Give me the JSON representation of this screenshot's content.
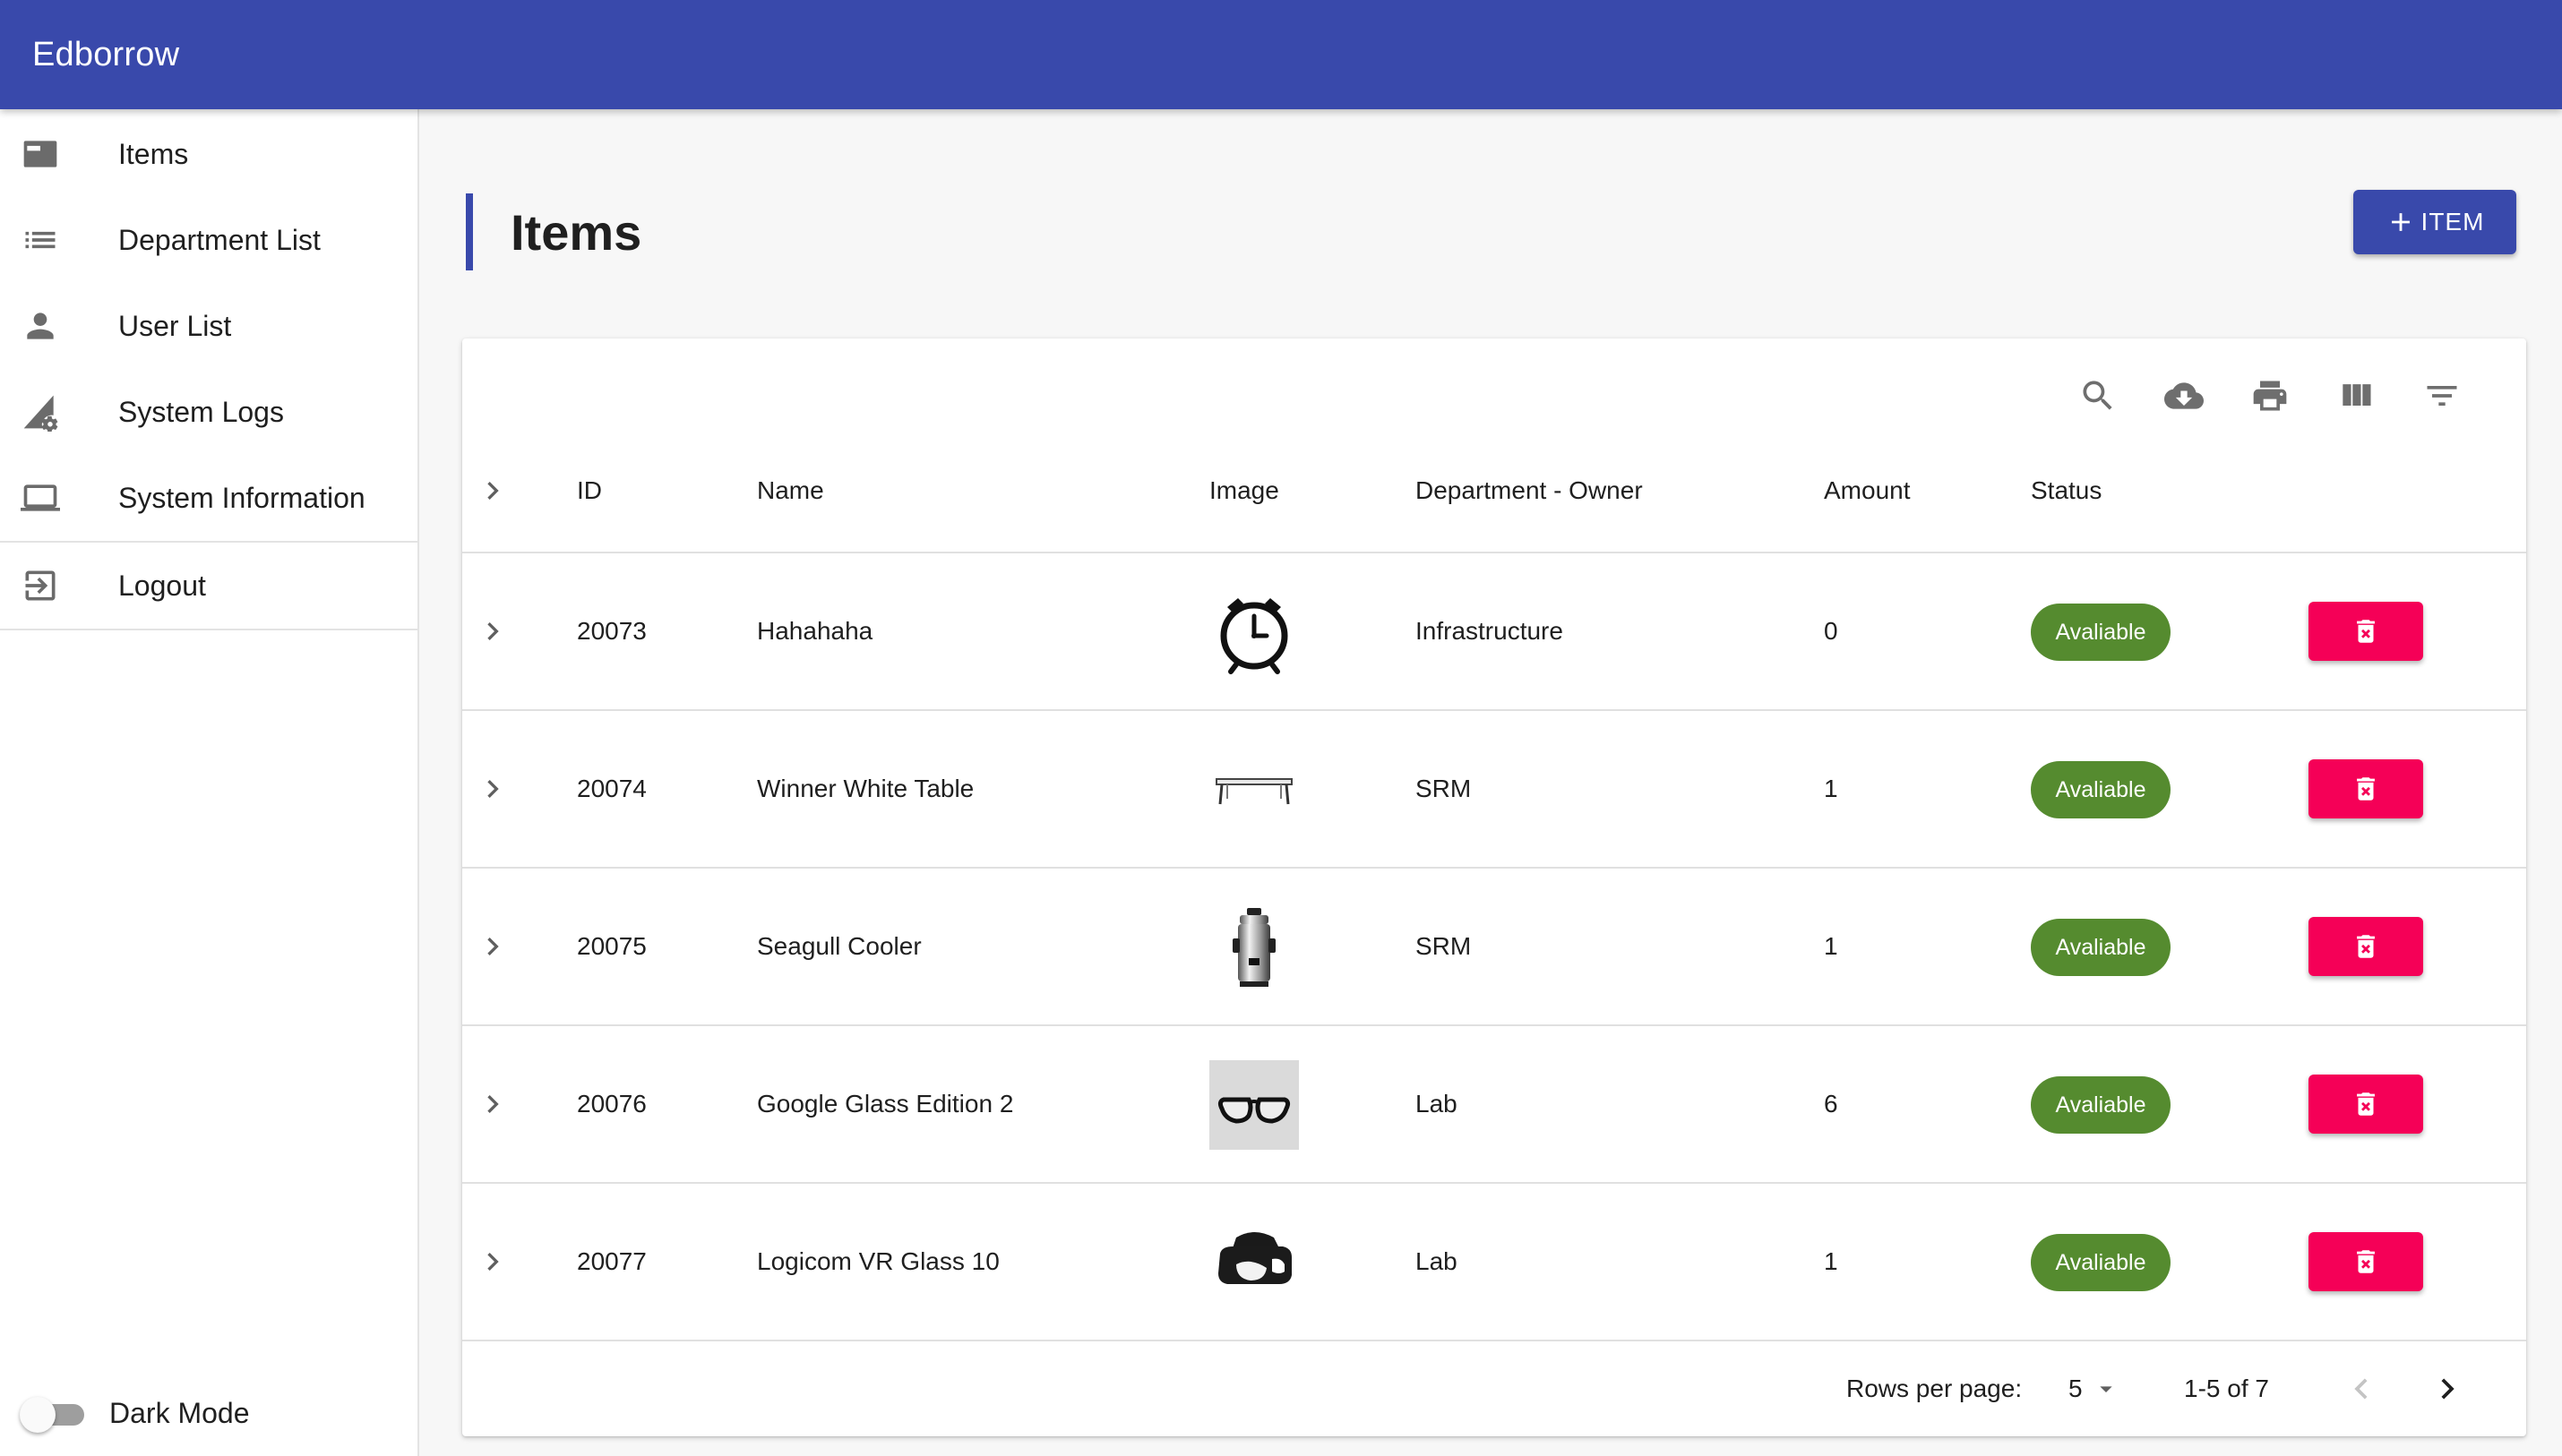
{
  "app": {
    "title": "Edborrow"
  },
  "sidebar": {
    "items": [
      {
        "label": "Items",
        "icon": "items-card-icon"
      },
      {
        "label": "Department List",
        "icon": "list-icon"
      },
      {
        "label": "User List",
        "icon": "person-icon"
      },
      {
        "label": "System Logs",
        "icon": "signal-cog-icon"
      },
      {
        "label": "System Information",
        "icon": "laptop-icon"
      }
    ],
    "logout": {
      "label": "Logout",
      "icon": "logout-icon"
    },
    "dark_mode": {
      "label": "Dark Mode",
      "enabled": false
    }
  },
  "page": {
    "title": "Items",
    "add_button": "ITEM"
  },
  "toolbar": {
    "icons": [
      "search-icon",
      "cloud-download-icon",
      "print-icon",
      "view-columns-icon",
      "filter-icon"
    ]
  },
  "table": {
    "columns": [
      "ID",
      "Name",
      "Image",
      "Department - Owner",
      "Amount",
      "Status"
    ],
    "rows": [
      {
        "id": "20073",
        "name": "Hahahaha",
        "image": "alarm-clock",
        "department": "Infrastructure",
        "amount": "0",
        "status": "Avaliable"
      },
      {
        "id": "20074",
        "name": "Winner White Table",
        "image": "folding-table",
        "department": "SRM",
        "amount": "1",
        "status": "Avaliable"
      },
      {
        "id": "20075",
        "name": "Seagull Cooler",
        "image": "water-boiler",
        "department": "SRM",
        "amount": "1",
        "status": "Avaliable"
      },
      {
        "id": "20076",
        "name": "Google Glass Edition 2",
        "image": "glasses",
        "department": "Lab",
        "amount": "6",
        "status": "Avaliable"
      },
      {
        "id": "20077",
        "name": "Logicom VR Glass 10",
        "image": "vr-headset",
        "department": "Lab",
        "amount": "1",
        "status": "Avaliable"
      }
    ]
  },
  "pagination": {
    "rows_per_page_label": "Rows per page:",
    "rows_per_page": "5",
    "range": "1-5 of 7"
  },
  "colors": {
    "primary": "#3949ab",
    "status_available": "#558b2f",
    "delete": "#f50057"
  }
}
